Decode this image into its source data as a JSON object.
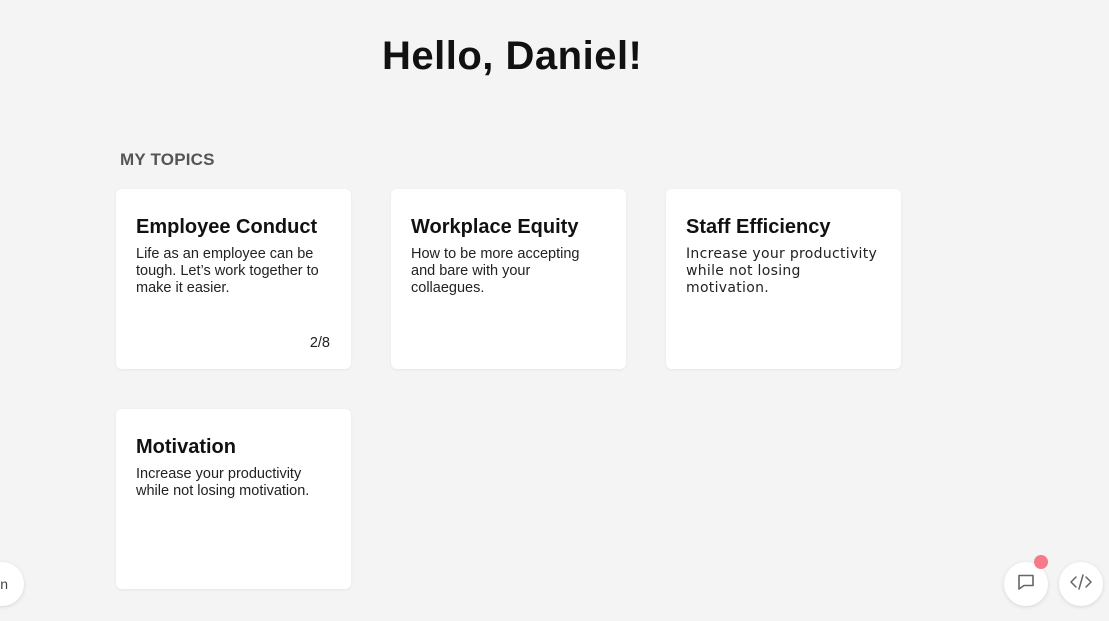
{
  "header": {
    "greeting": "Hello, Daniel!"
  },
  "topics": {
    "section_title": "MY TOPICS",
    "cards": [
      {
        "title": "Employee Conduct",
        "description": "Life as an employee can be tough. Let’s work together to make it easier.",
        "progress": "2/8"
      },
      {
        "title": "Workplace Equity",
        "description": "How to be more accepting and bare with your collaegues."
      },
      {
        "title": "Staff Efficiency",
        "description": "Increase your productivity while not losing motivation."
      },
      {
        "title": "Motivation",
        "description": "Increase your productivity while not losing motivation."
      }
    ]
  },
  "floating": {
    "left_button_text": "n",
    "chat_icon": "chat-icon",
    "code_icon": "code-icon",
    "notification_color": "#f77a8a"
  }
}
